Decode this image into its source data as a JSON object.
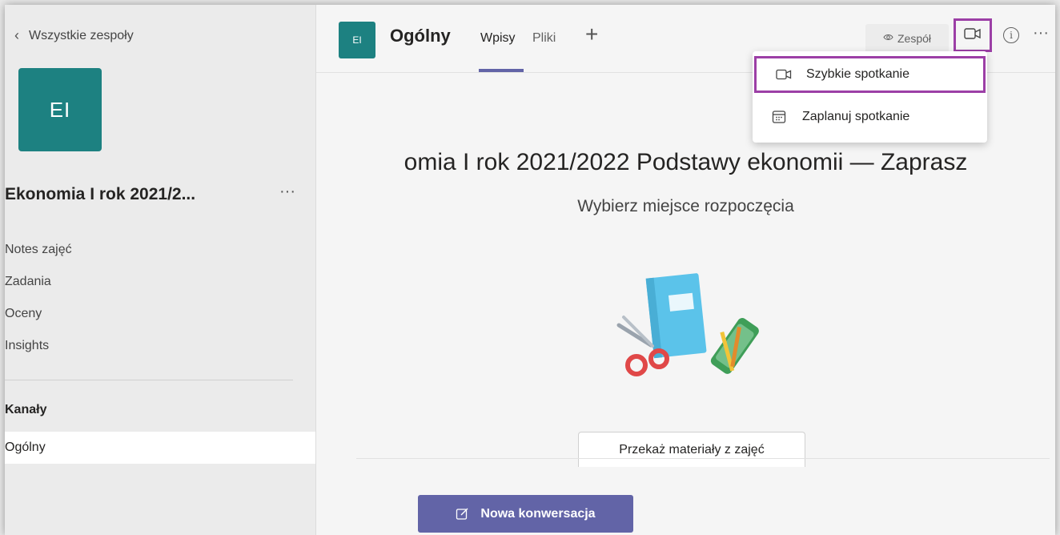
{
  "sidebar": {
    "back_label": "Wszystkie zespoły",
    "team_initials": "EI",
    "team_name": "Ekonomia I rok 2021/2...",
    "team_more": "···",
    "nav": [
      "Notes zajęć",
      "Zadania",
      "Oceny",
      "Insights"
    ],
    "channels_heading": "Kanały",
    "channels": [
      "Ogólny"
    ]
  },
  "header": {
    "channel_initials": "EI",
    "channel_name": "Ogólny",
    "tabs": [
      "Wpisy",
      "Pliki"
    ],
    "active_tab": "Wpisy",
    "add_tab": "+",
    "team_button_label": "Zespół",
    "info_glyph": "i",
    "more_glyph": "···",
    "accent_color": "#6264a7",
    "highlight_color": "#9c3fa6"
  },
  "meeting_menu": {
    "items": [
      {
        "label": "Szybkie spotkanie",
        "icon": "video-camera-icon",
        "highlighted": true
      },
      {
        "label": "Zaplanuj spotkanie",
        "icon": "calendar-icon",
        "highlighted": false
      }
    ]
  },
  "main": {
    "welcome_title": "omia I rok 2021/2022 Podstawy ekonomii — Zaprasz",
    "welcome_subtitle": "Wybierz miejsce rozpoczęcia",
    "share_button": "Przekaż materiały z zajęć",
    "new_conversation": "Nowa konwersacja"
  }
}
